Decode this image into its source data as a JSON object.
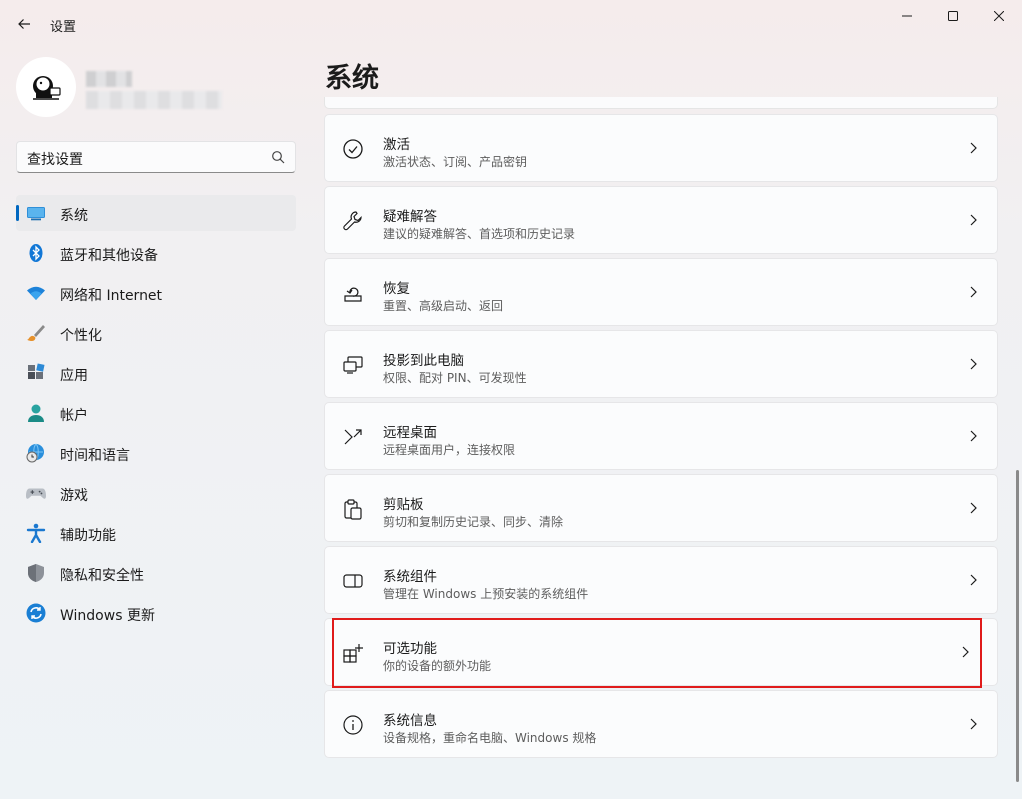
{
  "app": {
    "title": "设置"
  },
  "profile": {
    "avatar": "avatar-icon"
  },
  "search": {
    "placeholder": "查找设置"
  },
  "sidebar": {
    "items": [
      {
        "label": "系统",
        "icon": "system-icon",
        "active": true
      },
      {
        "label": "蓝牙和其他设备",
        "icon": "bluetooth-icon"
      },
      {
        "label": "网络和 Internet",
        "icon": "wifi-icon"
      },
      {
        "label": "个性化",
        "icon": "brush-icon"
      },
      {
        "label": "应用",
        "icon": "apps-icon"
      },
      {
        "label": "帐户",
        "icon": "account-icon"
      },
      {
        "label": "时间和语言",
        "icon": "globe-clock-icon"
      },
      {
        "label": "游戏",
        "icon": "gamepad-icon"
      },
      {
        "label": "辅助功能",
        "icon": "accessibility-icon"
      },
      {
        "label": "隐私和安全性",
        "icon": "shield-icon"
      },
      {
        "label": "Windows 更新",
        "icon": "update-icon"
      }
    ]
  },
  "main": {
    "title": "系统",
    "cards": [
      {
        "title": "激活",
        "subtitle": "激活状态、订阅、产品密钥",
        "icon": "activation-check-icon"
      },
      {
        "title": "疑难解答",
        "subtitle": "建议的疑难解答、首选项和历史记录",
        "icon": "wrench-icon"
      },
      {
        "title": "恢复",
        "subtitle": "重置、高级启动、返回",
        "icon": "recovery-icon"
      },
      {
        "title": "投影到此电脑",
        "subtitle": "权限、配对 PIN、可发现性",
        "icon": "project-icon"
      },
      {
        "title": "远程桌面",
        "subtitle": "远程桌面用户，连接权限",
        "icon": "remote-desktop-icon"
      },
      {
        "title": "剪贴板",
        "subtitle": "剪切和复制历史记录、同步、清除",
        "icon": "clipboard-icon"
      },
      {
        "title": "系统组件",
        "subtitle": "管理在 Windows 上预安装的系统组件",
        "icon": "system-components-icon"
      },
      {
        "title": "可选功能",
        "subtitle": "你的设备的额外功能",
        "icon": "optional-features-icon",
        "highlighted": true
      },
      {
        "title": "系统信息",
        "subtitle": "设备规格，重命名电脑、Windows 规格",
        "icon": "info-icon"
      }
    ]
  },
  "colors": {
    "accent": "#0067c0",
    "highlight": "#e01b1b"
  }
}
